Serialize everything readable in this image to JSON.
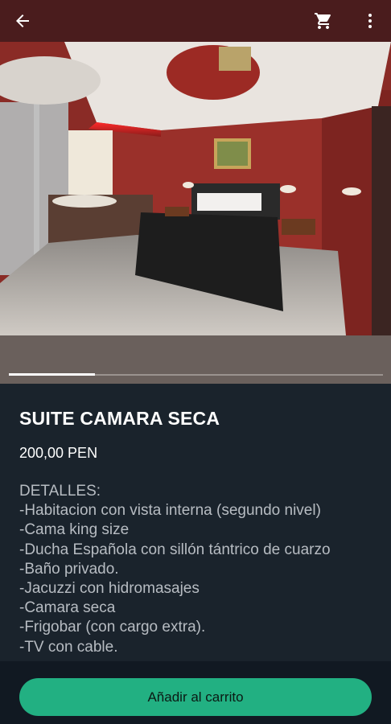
{
  "header": {
    "back_icon": "arrow-left-icon",
    "cart_icon": "shopping-cart-icon",
    "more_icon": "more-vertical-icon",
    "background": "#4a1c1d"
  },
  "gallery": {
    "progress_fraction": 0.23
  },
  "product": {
    "title": "SUITE CAMARA SECA",
    "price": "200,00 PEN",
    "details_heading": "DETALLES:",
    "details": [
      "-Habitacion con vista interna (segundo nivel)",
      "-Cama king size",
      "-Ducha Española con sillón tántrico de cuarzo",
      "-Baño privado.",
      "-Jacuzzi con hidromasajes",
      "-Camara seca",
      "-Frigobar (con cargo extra).",
      "-TV con cable."
    ]
  },
  "footer": {
    "add_to_cart_label": "Añadir al carrito",
    "accent": "#22b082"
  }
}
